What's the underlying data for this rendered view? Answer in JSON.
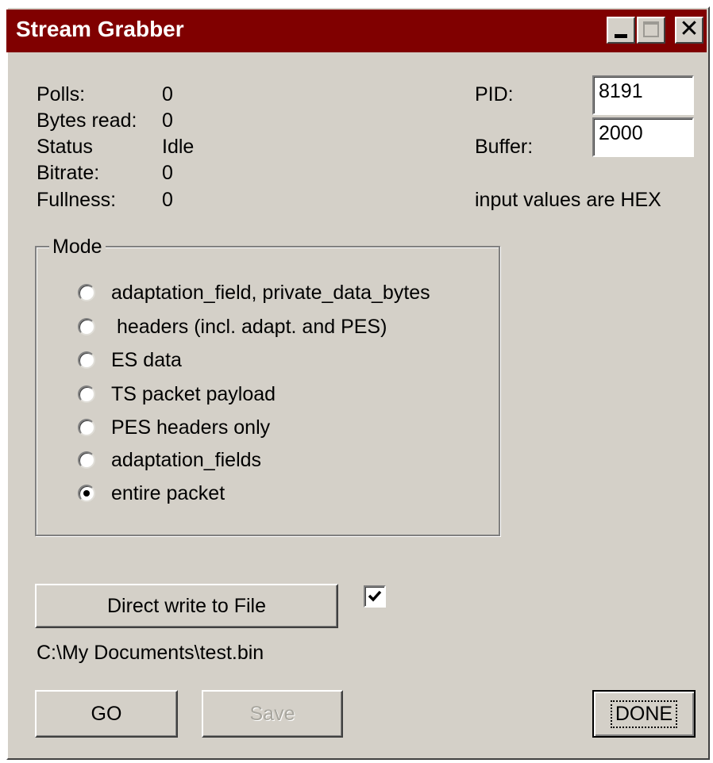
{
  "window": {
    "title": "Stream Grabber"
  },
  "stats": {
    "polls_label": "Polls:",
    "polls_value": "0",
    "bytes_label": "Bytes read:",
    "bytes_value": "0",
    "status_label": "Status",
    "status_value": "Idle",
    "bitrate_label": "Bitrate:",
    "bitrate_value": "0",
    "fullness_label": "Fullness:",
    "fullness_value": "0"
  },
  "inputs": {
    "pid_label": "PID:",
    "pid_value": "8191",
    "buffer_label": "Buffer:",
    "buffer_value": "2000",
    "hint": "input values are HEX"
  },
  "mode": {
    "legend": "Mode",
    "options": [
      {
        "label": "adaptation_field, private_data_bytes",
        "selected": false
      },
      {
        "label": " headers (incl. adapt. and PES)",
        "selected": false
      },
      {
        "label": "ES data",
        "selected": false
      },
      {
        "label": "TS packet payload",
        "selected": false
      },
      {
        "label": "PES headers only",
        "selected": false
      },
      {
        "label": "adaptation_fields",
        "selected": false
      },
      {
        "label": "entire packet",
        "selected": true
      }
    ]
  },
  "file": {
    "direct_write_label": "Direct write to File",
    "direct_write_checked": true,
    "path": "C:\\My Documents\\test.bin"
  },
  "actions": {
    "go_label": "GO",
    "save_label": "Save",
    "done_label": "DONE"
  },
  "colors": {
    "titlebar": "#800000",
    "face": "#d4d0c8"
  }
}
